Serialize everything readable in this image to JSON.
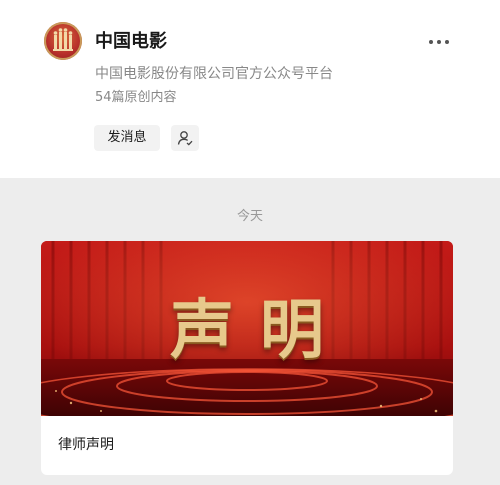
{
  "account": {
    "name": "中国电影",
    "description": "中国电影股份有限公司官方公众号平台",
    "article_count": "54篇原创内容",
    "avatar_icon": "china-film-logo-icon"
  },
  "actions": {
    "message_label": "发消息",
    "follow_icon": "user-follow-icon",
    "more_icon": "more-dots-icon"
  },
  "feed": {
    "date_label": "今天",
    "articles": [
      {
        "banner_text": "声明",
        "title": "律师声明"
      }
    ]
  },
  "colors": {
    "banner_red": "#b11616",
    "gold_text": "#e7c98c",
    "page_bg": "#ededed"
  }
}
